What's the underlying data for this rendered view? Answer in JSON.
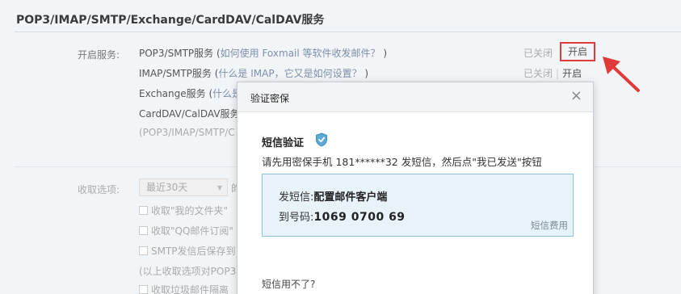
{
  "section": {
    "title": "POP3/IMAP/SMTP/Exchange/CardDAV/CalDAV服务"
  },
  "services": {
    "label": "开启服务:",
    "items": [
      {
        "name": "POP3/SMTP服务 (",
        "help": "如何使用 Foxmail 等软件收发邮件？",
        "close": ")",
        "status": "已关闭",
        "action": "开启"
      },
      {
        "name": "IMAP/SMTP服务 (",
        "help": "什么是 IMAP，它又是如何设置？",
        "close": ")",
        "status": "已关闭",
        "action": "开启"
      },
      {
        "name": "Exchange服务 (",
        "help": "什么是"
      },
      {
        "name": "CardDAV/CalDAV服务"
      },
      {
        "name": "(POP3/IMAP/SMTP/C"
      }
    ]
  },
  "receive": {
    "label": "收取选项:",
    "select_value": "最近30天",
    "select_after": "的",
    "checks": [
      "收取\"我的文件夹\"",
      "收取\"QQ邮件订阅\"",
      "SMTP发信后保存到"
    ],
    "note": "(以上收取选项对POP3",
    "last_check": "收取垃圾邮件隔离"
  },
  "modal": {
    "title": "验证密保",
    "close_glyph": "×",
    "verify_title": "短信验证",
    "desc": "请先用密保手机 181******32 发短信，然后点\"我已发送\"按钮",
    "sms": {
      "send_label": "发短信:",
      "send_value": "配置邮件客户端",
      "to_label": "到号码:",
      "to_value": "1069 0700 69",
      "fee": "短信费用"
    },
    "fail_text": "短信用不了?"
  },
  "colors": {
    "highlight": "#e03a3a",
    "sms_bg": "#e7f3f9",
    "sms_border": "#8cc3dd"
  }
}
